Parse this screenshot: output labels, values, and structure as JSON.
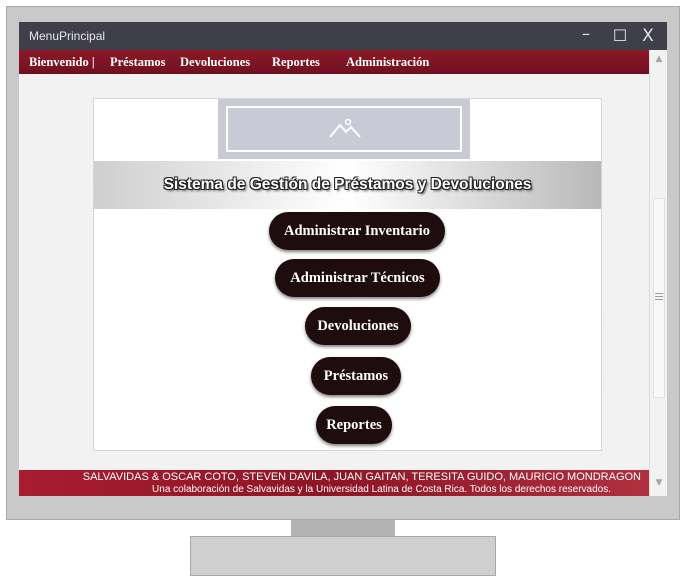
{
  "window": {
    "title": "MenuPrincipal",
    "minimize_glyph": "–",
    "maximize_glyph": "☐",
    "close_glyph": "X"
  },
  "menu": {
    "items": [
      "Bienvenido |",
      "Préstamos",
      "Devoluciones",
      "Reportes",
      "Administración"
    ]
  },
  "main": {
    "logo_icon": "image-placeholder-icon",
    "title": "Sistema de Gestión de Préstamos y Devoluciones",
    "buttons": [
      "Administrar Inventario",
      "Administrar Técnicos",
      "Devoluciones",
      "Préstamos",
      "Reportes"
    ]
  },
  "footer": {
    "authors": "SALVAVIDAS & OSCAR COTO, STEVEN DAVILA, JUAN GAITAN, TERESITA GUIDO, MAURICIO MONDRAGON",
    "note": "Una colaboración de Salvavidas y la Universidad Latina de Costa Rica. Todos los derechos reservados."
  },
  "colors": {
    "menu_bar": "#7d1524",
    "title_bar": "#3f3f49",
    "button": "#1e0c0e",
    "footer": "#9c1a2c"
  },
  "scrollbar": {
    "up_icon": "scroll-up-icon",
    "down_icon": "scroll-down-icon",
    "up_glyph": "▲",
    "down_glyph": "▼"
  }
}
